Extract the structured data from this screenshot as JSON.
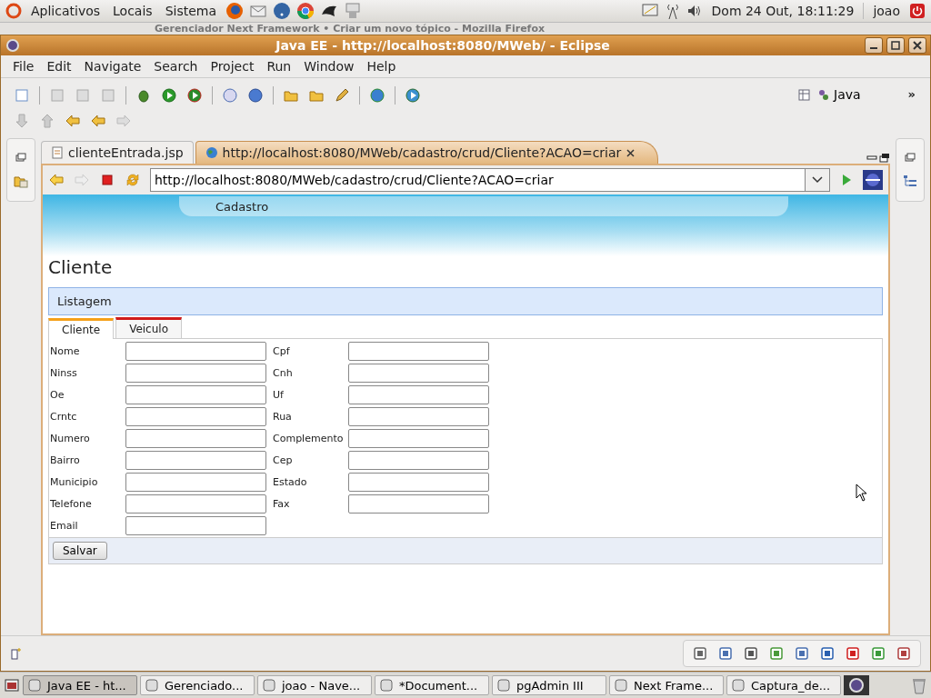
{
  "top_panel": {
    "menus": [
      "Aplicativos",
      "Locais",
      "Sistema"
    ],
    "clock": "Dom 24 Out, 18:11:29",
    "user": "joao"
  },
  "background_window": {
    "title": "Gerenciador Next Framework • Criar um novo tópico - Mozilla Firefox"
  },
  "window": {
    "title": "Java EE - http://localhost:8080/MWeb/ - Eclipse"
  },
  "menu": [
    "File",
    "Edit",
    "Navigate",
    "Search",
    "Project",
    "Run",
    "Window",
    "Help"
  ],
  "perspective": {
    "label": "Java",
    "more": "»"
  },
  "editor_tabs": [
    {
      "label": "clienteEntrada.jsp",
      "selected": false,
      "closable": false
    },
    {
      "label": "http://localhost:8080/MWeb/cadastro/crud/Cliente?ACAO=criar",
      "selected": true,
      "closable": true
    }
  ],
  "address": {
    "value": "http://localhost:8080/MWeb/cadastro/crud/Cliente?ACAO=criar"
  },
  "page": {
    "banner_menu": "Cadastro",
    "heading": "Cliente",
    "section": "Listagem",
    "tabs": [
      {
        "label": "Cliente",
        "selected": true,
        "color": "#f5a01a"
      },
      {
        "label": "Veiculo",
        "selected": false,
        "color": "#d01c1c"
      }
    ],
    "rows": [
      {
        "left": "Nome",
        "right": "Cpf"
      },
      {
        "left": "Ninss",
        "right": "Cnh"
      },
      {
        "left": "Oe",
        "right": "Uf"
      },
      {
        "left": "Crntc",
        "right": "Rua"
      },
      {
        "left": "Numero",
        "right": "Complemento"
      },
      {
        "left": "Bairro",
        "right": "Cep"
      },
      {
        "left": "Municipio",
        "right": "Estado"
      },
      {
        "left": "Telefone",
        "right": "Fax"
      },
      {
        "left": "Email"
      }
    ],
    "button": "Salvar"
  },
  "taskbar": [
    {
      "label": "Java EE - ht...",
      "selected": true
    },
    {
      "label": "Gerenciado...",
      "selected": false
    },
    {
      "label": "joao - Nave...",
      "selected": false
    },
    {
      "label": "*Document...",
      "selected": false
    },
    {
      "label": "pgAdmin III",
      "selected": false
    },
    {
      "label": "Next Frame...",
      "selected": false
    },
    {
      "label": "Captura_de...",
      "selected": false
    }
  ]
}
